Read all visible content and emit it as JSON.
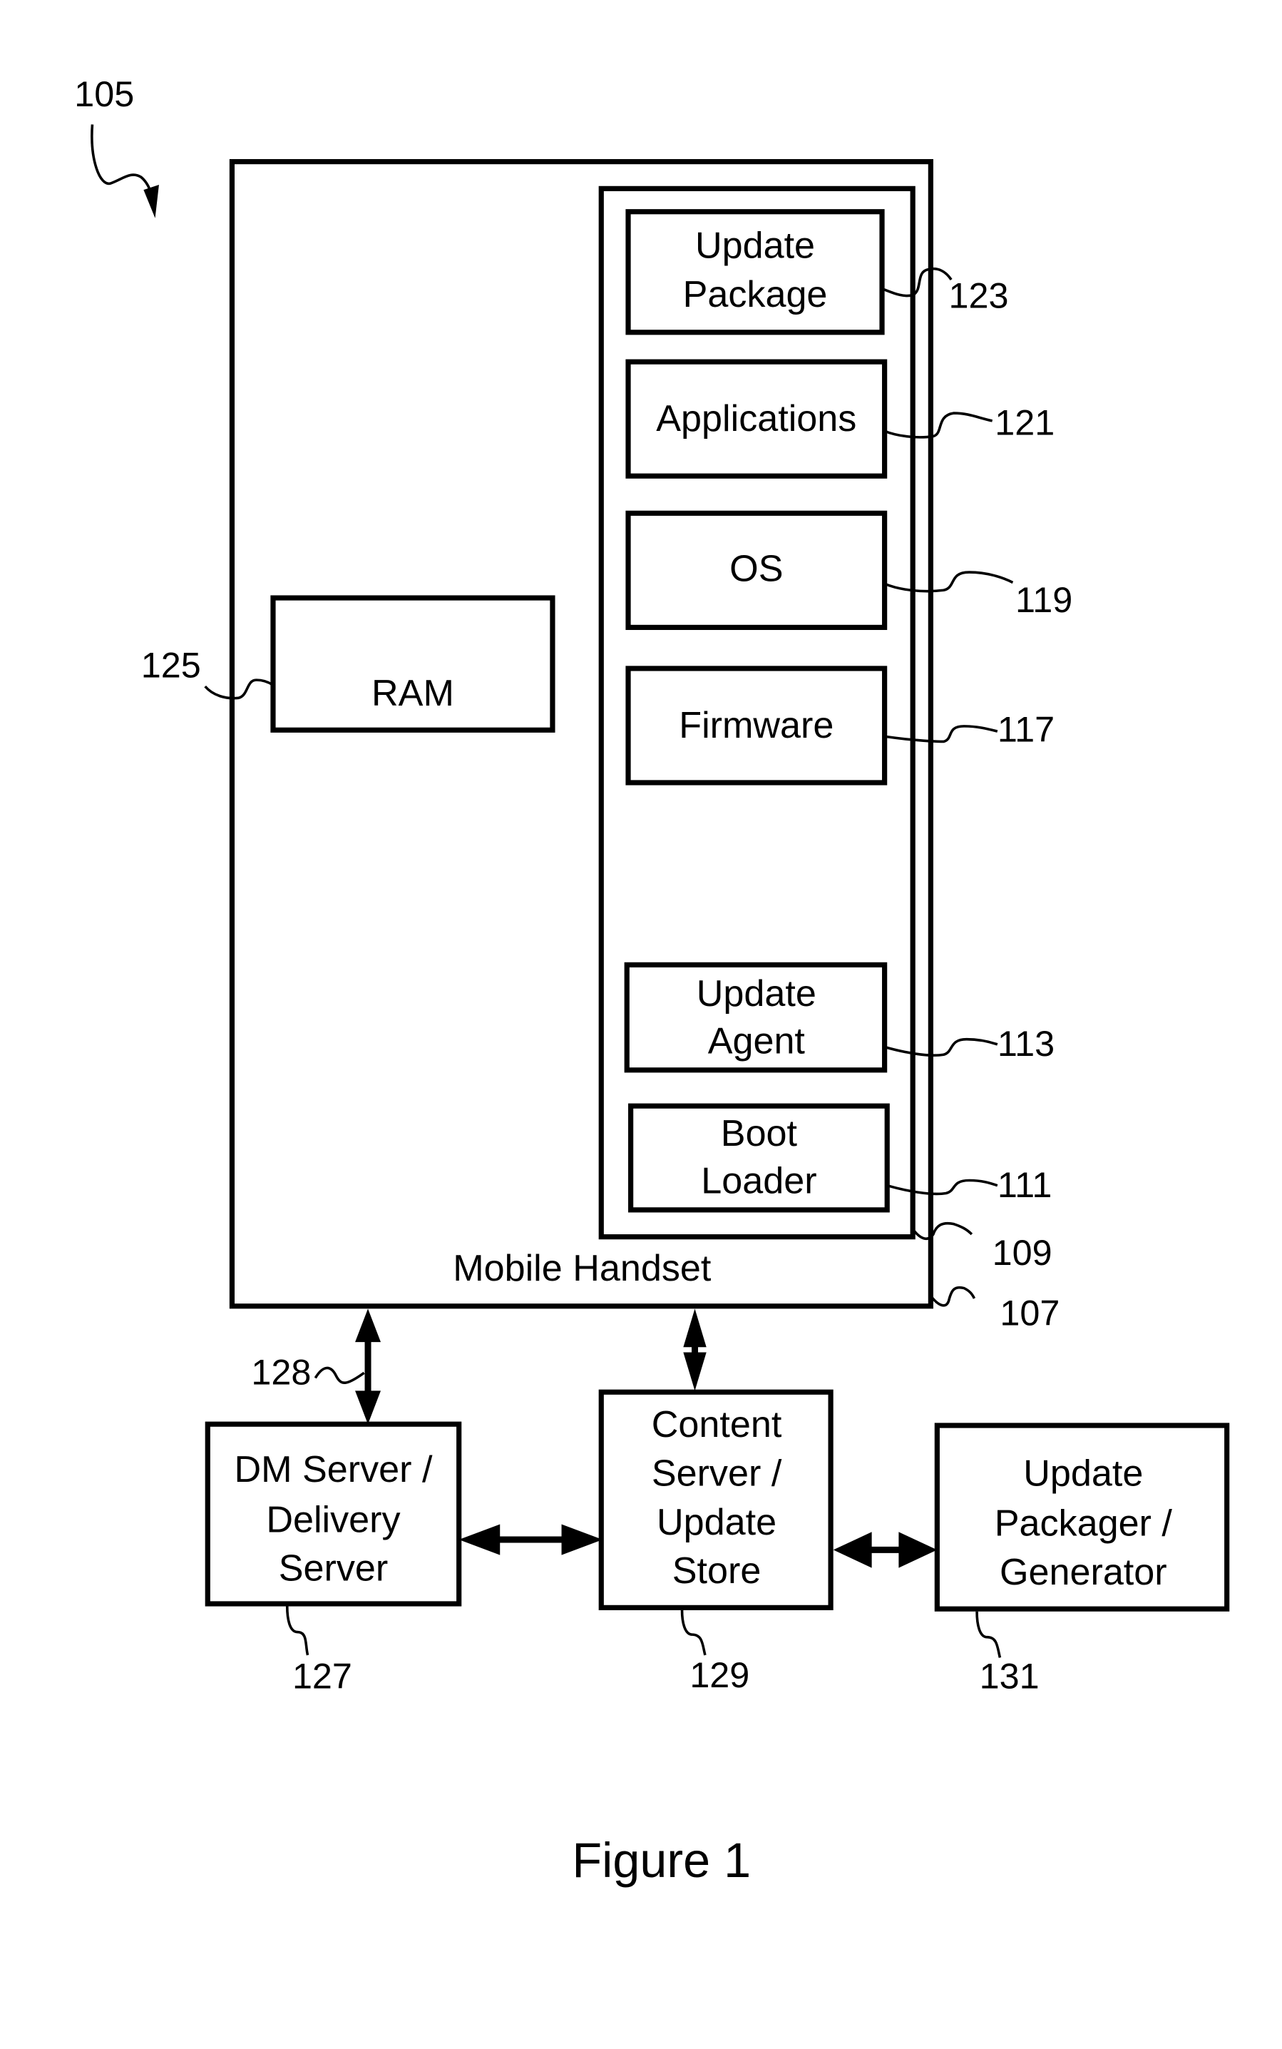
{
  "figure": {
    "caption": "Figure 1",
    "ref_system": "105"
  },
  "handset": {
    "label": "Mobile Handset",
    "ref": "107",
    "memory_ref": "109",
    "ram": {
      "label": "RAM",
      "ref": "125"
    },
    "components": [
      {
        "lines": [
          "Update",
          "Package"
        ],
        "ref": "123"
      },
      {
        "lines": [
          "Applications"
        ],
        "ref": "121"
      },
      {
        "lines": [
          "OS"
        ],
        "ref": "119"
      },
      {
        "lines": [
          "Firmware"
        ],
        "ref": "117"
      },
      {
        "lines": [
          "Update",
          "Agent"
        ],
        "ref": "113"
      },
      {
        "lines": [
          "Boot",
          "Loader"
        ],
        "ref": "111"
      }
    ]
  },
  "servers": [
    {
      "lines": [
        "DM Server /",
        "Delivery",
        "Server"
      ],
      "ref": "127"
    },
    {
      "lines": [
        "Content",
        "Server /",
        "Update",
        "Store"
      ],
      "ref": "129"
    },
    {
      "lines": [
        "Update",
        "Packager /",
        "Generator"
      ],
      "ref": "131"
    }
  ],
  "links": {
    "handset_dm_ref": "128"
  }
}
